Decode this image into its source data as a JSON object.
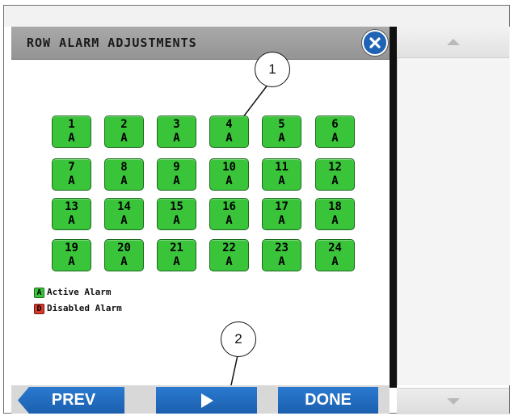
{
  "dialog": {
    "title": "ROW ALARM ADJUSTMENTS",
    "close_icon": "close-icon"
  },
  "rows": [
    {
      "number": "1",
      "state": "A"
    },
    {
      "number": "2",
      "state": "A"
    },
    {
      "number": "3",
      "state": "A"
    },
    {
      "number": "4",
      "state": "A"
    },
    {
      "number": "5",
      "state": "A"
    },
    {
      "number": "6",
      "state": "A"
    },
    {
      "number": "7",
      "state": "A"
    },
    {
      "number": "8",
      "state": "A"
    },
    {
      "number": "9",
      "state": "A"
    },
    {
      "number": "10",
      "state": "A"
    },
    {
      "number": "11",
      "state": "A"
    },
    {
      "number": "12",
      "state": "A"
    },
    {
      "number": "13",
      "state": "A"
    },
    {
      "number": "14",
      "state": "A"
    },
    {
      "number": "15",
      "state": "A"
    },
    {
      "number": "16",
      "state": "A"
    },
    {
      "number": "17",
      "state": "A"
    },
    {
      "number": "18",
      "state": "A"
    },
    {
      "number": "19",
      "state": "A"
    },
    {
      "number": "20",
      "state": "A"
    },
    {
      "number": "21",
      "state": "A"
    },
    {
      "number": "22",
      "state": "A"
    },
    {
      "number": "23",
      "state": "A"
    },
    {
      "number": "24",
      "state": "A"
    }
  ],
  "legend": {
    "active": {
      "key": "A",
      "label": "Active Alarm",
      "color": "#39c43a"
    },
    "disabled": {
      "key": "D",
      "label": "Disabled Alarm",
      "color": "#d63a2a"
    }
  },
  "callouts": [
    "1",
    "2"
  ],
  "buttons": {
    "prev": "PREV",
    "play_icon": "play-icon",
    "done": "DONE"
  },
  "scrollbar": {
    "up_icon": "triangle-up-icon",
    "down_icon": "triangle-down-icon"
  },
  "colors": {
    "accent": "#1e63b4",
    "active_alarm": "#39c43a",
    "disabled_alarm": "#d63a2a"
  }
}
